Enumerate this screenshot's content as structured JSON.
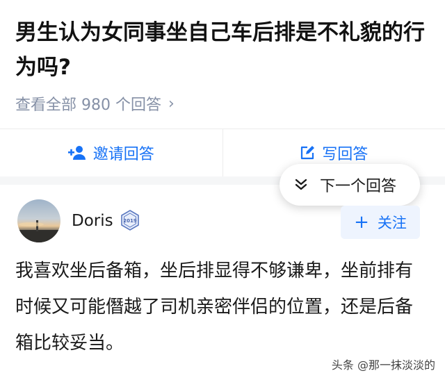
{
  "question": {
    "title": "男生认为女同事坐自己车后排是不礼貌的行为吗?"
  },
  "view_all": {
    "label": "查看全部 980 个回答",
    "chevron": "›"
  },
  "actions": {
    "invite_label": "邀请回答",
    "write_label": "写回答"
  },
  "next_popup": {
    "label": "下一个回答"
  },
  "answer": {
    "author": "Doris",
    "badge_text": "2019",
    "follow_label": "关注",
    "follow_plus": "+",
    "body": "我喜欢坐后备箱，坐后排显得不够谦卑，坐前排有时候又可能僭越了司机亲密伴侣的位置，还是后备箱比较妥当。"
  },
  "watermark": {
    "text": "头条 @那一抹淡淡的"
  },
  "colors": {
    "accent": "#1772f6",
    "muted": "#8590a6"
  },
  "icons": {
    "invite": "add-person-icon",
    "write": "edit-icon",
    "next": "double-chevron-down-icon",
    "badge": "medal-badge-icon",
    "view_all_chevron": "chevron-right-icon"
  }
}
